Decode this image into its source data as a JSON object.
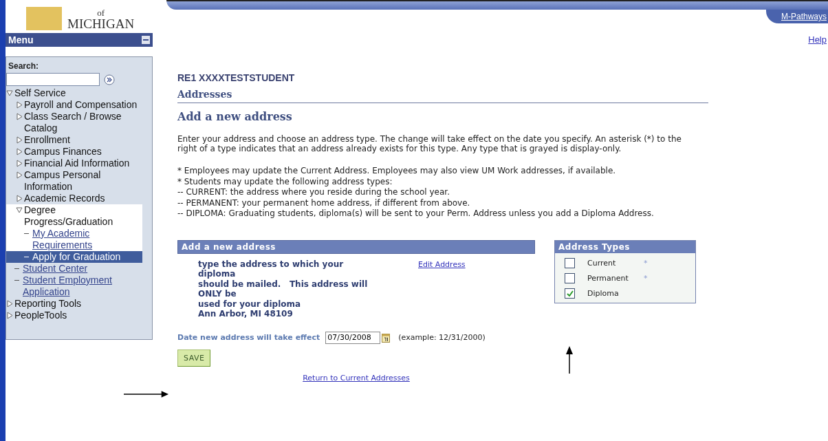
{
  "logo": {
    "line_1": "of",
    "line_2": "MICHIGAN"
  },
  "menu": {
    "title": "Menu",
    "search_label": "Search:",
    "items": [
      {
        "kind": "folder",
        "label": "Self Service",
        "expanded": true,
        "children": [
          {
            "kind": "folder",
            "label": "Payroll and Compensation",
            "expanded": false
          },
          {
            "kind": "folder",
            "label": "Class Search / Browse Catalog",
            "expanded": false
          },
          {
            "kind": "folder",
            "label": "Enrollment",
            "expanded": false
          },
          {
            "kind": "folder",
            "label": "Campus Finances",
            "expanded": false
          },
          {
            "kind": "folder",
            "label": "Financial Aid Information",
            "expanded": false
          },
          {
            "kind": "folder",
            "label": "Campus Personal Information",
            "expanded": false
          },
          {
            "kind": "folder",
            "label": "Academic Records",
            "expanded": false
          },
          {
            "kind": "folder",
            "label": "Degree Progress/Graduation",
            "expanded": true,
            "children": [
              {
                "kind": "link",
                "label": "My Academic Requirements",
                "selected": false
              },
              {
                "kind": "link",
                "label": "Apply for Graduation",
                "selected": true
              }
            ]
          },
          {
            "kind": "link",
            "label": "Student Center",
            "selected": false
          },
          {
            "kind": "link",
            "label": "Student Employment Application",
            "selected": false
          }
        ]
      },
      {
        "kind": "folder",
        "label": "Reporting Tools",
        "expanded": false
      },
      {
        "kind": "folder",
        "label": "PeopleTools",
        "expanded": false
      }
    ]
  },
  "header": {
    "tab": "M-Pathways",
    "help": "Help"
  },
  "page": {
    "student": "RE1 XXXXTESTSTUDENT",
    "title": "Addresses",
    "subtitle": "Add a new address",
    "intro": "Enter your address and choose an address type. The change will take effect on the date you specify.  An asterisk (*) to the right of a type indicates that an address already exists for this type. Any type that is grayed is display-only.",
    "notes": [
      "* Employees may update the Current Address. Employees may also view UM Work addresses, if available.",
      "* Students may update the following address types:",
      "-- CURRENT: the address where you reside during the school year.",
      "-- PERMANENT: your permanent home address, if different from above.",
      "-- DIPLOMA: Graduating students, diploma(s) will be sent to your Perm. Address unless you add a Diploma Address."
    ],
    "address_panel": {
      "title": "Add a new address",
      "lines": [
        "type the address to which your",
        "diploma",
        "should be mailed.   This address will",
        "ONLY be",
        "used for your diploma",
        "Ann Arbor, MI 48109"
      ],
      "edit_link": "Edit Address"
    },
    "address_types": {
      "title": "Address Types",
      "items": [
        {
          "label": "Current",
          "checked": false,
          "marker": "*"
        },
        {
          "label": "Permanent",
          "checked": false,
          "marker": "*"
        },
        {
          "label": "Diploma",
          "checked": true
        }
      ]
    },
    "effective_date": {
      "label": "Date new address will take effect",
      "value": "07/30/2008",
      "example": "(example: 12/31/2000)"
    },
    "save": "SAVE",
    "return_link": "Return to Current Addresses"
  }
}
